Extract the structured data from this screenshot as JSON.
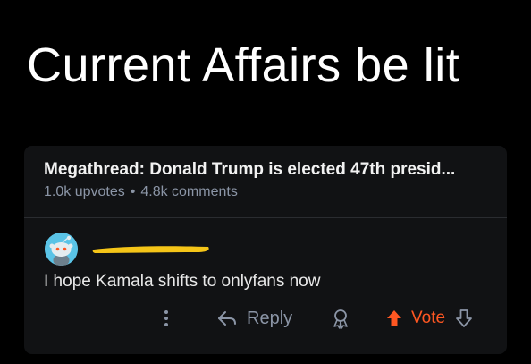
{
  "caption": "Current Affairs be lit",
  "post": {
    "title": "Megathread: Donald Trump is elected 47th presid...",
    "upvotes": "1.0k upvotes",
    "separator": "•",
    "comments": "4.8k comments"
  },
  "comment": {
    "text": "I hope Kamala shifts to onlyfans now"
  },
  "actions": {
    "reply_label": "Reply",
    "vote_label": "Vote",
    "more_icon": "more-vertical-icon",
    "reply_icon": "reply-arrow-icon",
    "award_icon": "award-icon",
    "upvote_icon": "upvote-arrow-icon",
    "downvote_icon": "downvote-arrow-icon"
  },
  "colors": {
    "background": "#000000",
    "card": "#111214",
    "muted_text": "#8b95a6",
    "vote_accent": "#ff5722",
    "avatar": "#5ac3e6",
    "redaction": "#f5c518"
  }
}
